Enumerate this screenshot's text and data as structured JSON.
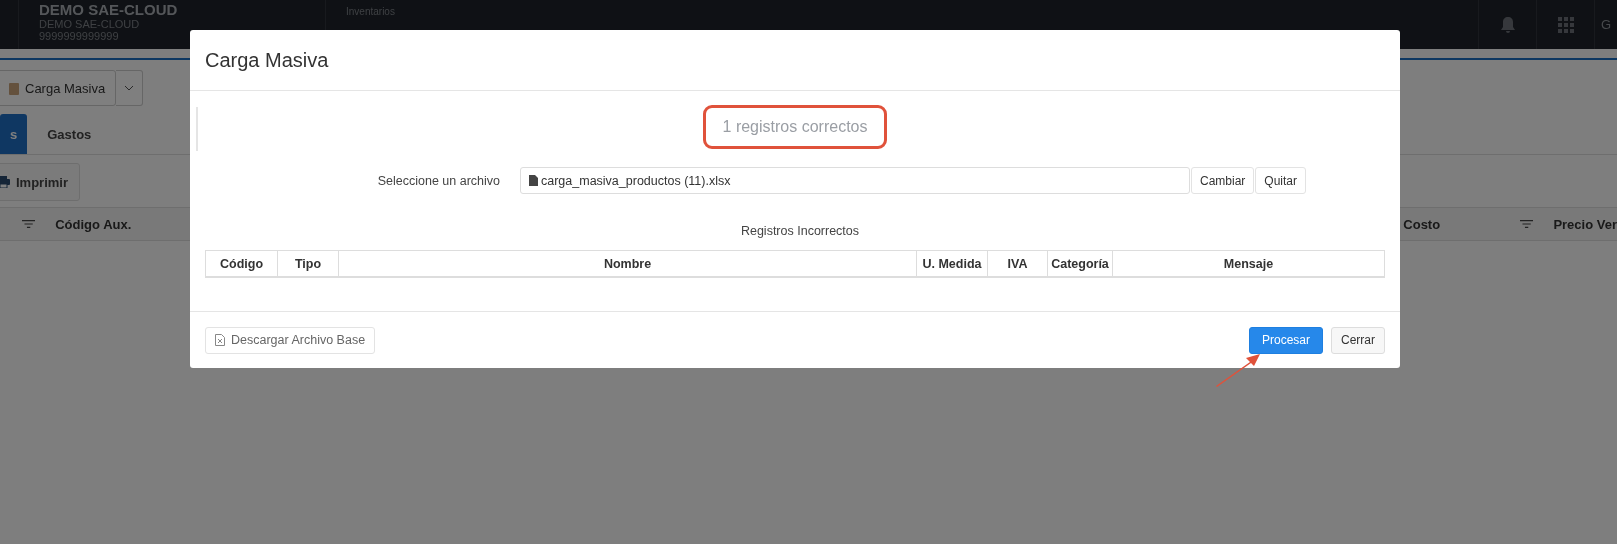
{
  "header": {
    "company": "DEMO SAE-CLOUD",
    "company_sub": "DEMO SAE-CLOUD",
    "company_id": "9999999999999",
    "section": "Inventarios",
    "user_initial": "G"
  },
  "toolbar": {
    "split_button": "Carga Masiva",
    "print_button": "Imprimir"
  },
  "tabs": [
    {
      "label": "s",
      "selected": true
    },
    {
      "label": "Gastos",
      "selected": false
    }
  ],
  "grid_columns": [
    "Código Aux.",
    "Costo",
    "Precio Ver"
  ],
  "modal": {
    "title": "Carga Masiva",
    "status": "1 registros correctos",
    "status_highlighted": true,
    "file_label": "Seleccione un archivo",
    "file_value": "carga_masiva_productos (11).xlsx",
    "change_button": "Cambiar",
    "remove_button": "Quitar",
    "table_title": "Registros Incorrectos",
    "columns": [
      "Código",
      "Tipo",
      "Nombre",
      "U. Medida",
      "IVA",
      "Categoría",
      "Mensaje"
    ],
    "download_button": "Descargar Archivo Base",
    "process_button": "Procesar",
    "close_button": "Cerrar"
  },
  "annotations": [
    {
      "kind": "arrow"
    }
  ]
}
